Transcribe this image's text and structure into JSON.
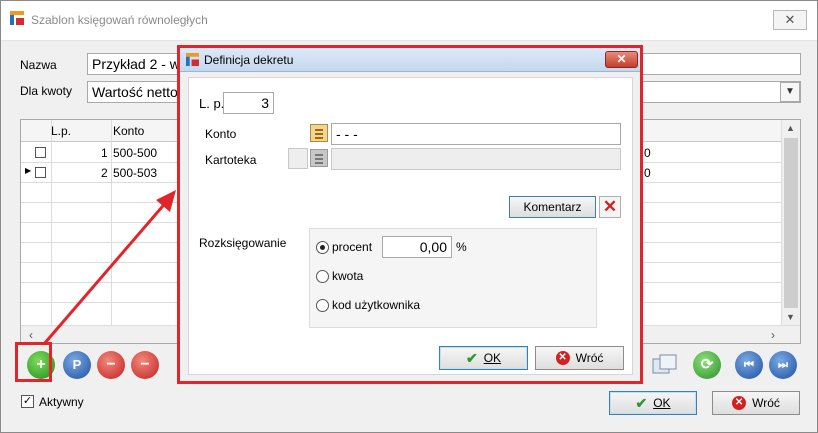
{
  "window": {
    "title": "Szablon księgowań równoległych"
  },
  "form": {
    "nazwa_label": "Nazwa",
    "nazwa_value": "Przykład 2 - w",
    "dla_kwoty_label": "Dla kwoty",
    "dla_kwoty_value": "Wartość netto"
  },
  "grid": {
    "columns": [
      "L.p.",
      "Konto"
    ],
    "rows": [
      {
        "lp": "1",
        "konto": "500-500",
        "right": "0"
      },
      {
        "lp": "2",
        "konto": "500-503",
        "right": "0"
      }
    ]
  },
  "footer": {
    "aktywny_label": "Aktywny",
    "aktywny_checked": "✓",
    "ok_label": "OK",
    "wroc_label": "Wróć"
  },
  "dialog": {
    "title": "Definicja dekretu",
    "lp_label": "L. p.",
    "lp_value": "3",
    "konto_label": "Konto",
    "konto_value": "-  -  -",
    "kartoteka_label": "Kartoteka",
    "komentarz_label": "Komentarz",
    "rozksiegowanie_label": "Rozksięgowanie",
    "procent_label": "procent",
    "procent_value": "0,00",
    "percent_sign": "%",
    "kwota_label": "kwota",
    "kod_label": "kod użytkownika",
    "ok_label": "OK",
    "wroc_label": "Wróć"
  },
  "colors": {
    "highlight": "#e0262b",
    "ok_check": "#2e9a2e",
    "cancel_red": "#d32020"
  }
}
